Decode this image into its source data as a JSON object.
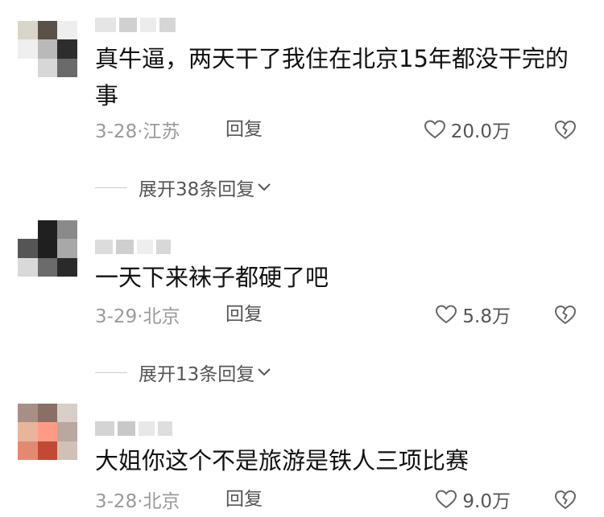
{
  "comments": [
    {
      "text": "真牛逼，两天干了我住在北京15年都没干完的事",
      "date_location": "3-28·江苏",
      "reply_label": "回复",
      "likes": "20.0万",
      "expand_label": "展开38条回复",
      "avatar_colors": [
        "#d9d5c8",
        "#5a5248",
        "#eeeeee",
        "#efefef",
        "#b9b9b9",
        "#2d2d2d",
        "#ffffff",
        "#d7d7d7",
        "#6a6a6a"
      ]
    },
    {
      "text": "一天下来袜子都硬了吧",
      "date_location": "3-29·北京",
      "reply_label": "回复",
      "likes": "5.8万",
      "expand_label": "展开13条回复",
      "avatar_colors": [
        "#ffffff",
        "#202020",
        "#8a8a8a",
        "#555555",
        "#1f1f1f",
        "#a8a8a8",
        "#d9d9d9",
        "#6b6b6b",
        "#2a2a2a"
      ]
    },
    {
      "text": "大姐你这个不是旅游是铁人三项比赛",
      "date_location": "3-28·北京",
      "reply_label": "回复",
      "likes": "9.0万",
      "avatar_colors": [
        "#a88f86",
        "#8a6f66",
        "#d8cfc9",
        "#e7b59c",
        "#ff9a86",
        "#b8a8a0",
        "#e28a70",
        "#c24a35",
        "#d0c0b6"
      ]
    }
  ],
  "icons": {
    "like": "heart-outline-icon",
    "dislike": "broken-heart-icon",
    "expand": "chevron-down-icon"
  }
}
